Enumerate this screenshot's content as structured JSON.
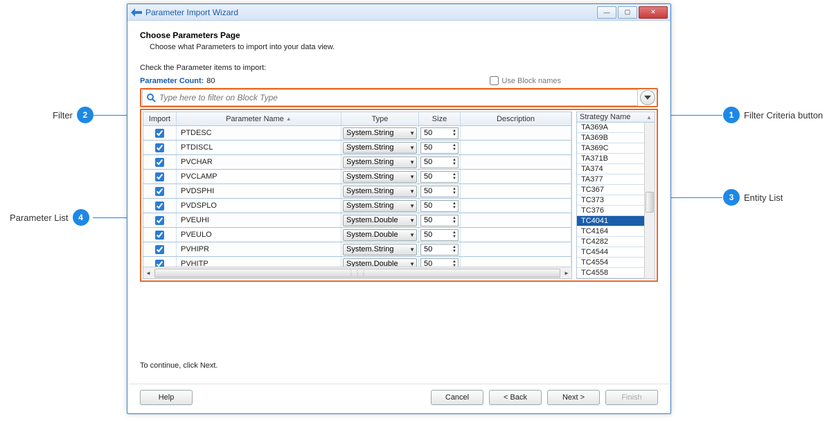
{
  "window": {
    "title": "Parameter Import Wizard"
  },
  "page": {
    "heading": "Choose Parameters Page",
    "subheading": "Choose what Parameters to import into your data view."
  },
  "instruction": "Check the Parameter items to import:",
  "counter": {
    "label": "Parameter Count:",
    "value": "80"
  },
  "blocknames": {
    "label": "Use Block names"
  },
  "filter": {
    "placeholder": "Type here to filter on Block Type"
  },
  "columns": {
    "import": "Import",
    "pname": "Parameter Name",
    "type": "Type",
    "size": "Size",
    "desc": "Description"
  },
  "rows": [
    {
      "checked": true,
      "name": "PTDESC",
      "type": "System.String",
      "size": "50",
      "desc": ""
    },
    {
      "checked": true,
      "name": "PTDISCL",
      "type": "System.String",
      "size": "50",
      "desc": ""
    },
    {
      "checked": true,
      "name": "PVCHAR",
      "type": "System.String",
      "size": "50",
      "desc": ""
    },
    {
      "checked": true,
      "name": "PVCLAMP",
      "type": "System.String",
      "size": "50",
      "desc": ""
    },
    {
      "checked": true,
      "name": "PVDSPHI",
      "type": "System.String",
      "size": "50",
      "desc": ""
    },
    {
      "checked": true,
      "name": "PVDSPLO",
      "type": "System.String",
      "size": "50",
      "desc": ""
    },
    {
      "checked": true,
      "name": "PVEUHI",
      "type": "System.Double",
      "size": "50",
      "desc": ""
    },
    {
      "checked": true,
      "name": "PVEULO",
      "type": "System.Double",
      "size": "50",
      "desc": ""
    },
    {
      "checked": true,
      "name": "PVHIPR",
      "type": "System.String",
      "size": "50",
      "desc": ""
    },
    {
      "checked": true,
      "name": "PVHITP",
      "type": "System.Double",
      "size": "50",
      "desc": ""
    }
  ],
  "entity": {
    "header": "Strategy Name",
    "items": [
      "TA369A",
      "TA369B",
      "TA369C",
      "TA371B",
      "TA374",
      "TA377",
      "TC367",
      "TC373",
      "TC376",
      "TC4041",
      "TC4164",
      "TC4282",
      "TC4544",
      "TC4554",
      "TC4558"
    ],
    "selected": "TC4041"
  },
  "continue_text": "To continue, click Next.",
  "buttons": {
    "help": "Help",
    "cancel": "Cancel",
    "back": "< Back",
    "next": "Next >",
    "finish": "Finish"
  },
  "callouts": {
    "c1": {
      "num": "1",
      "label": "Filter Criteria button"
    },
    "c2": {
      "num": "2",
      "label": "Filter"
    },
    "c3": {
      "num": "3",
      "label": "Entity List"
    },
    "c4": {
      "num": "4",
      "label": "Parameter List"
    }
  }
}
